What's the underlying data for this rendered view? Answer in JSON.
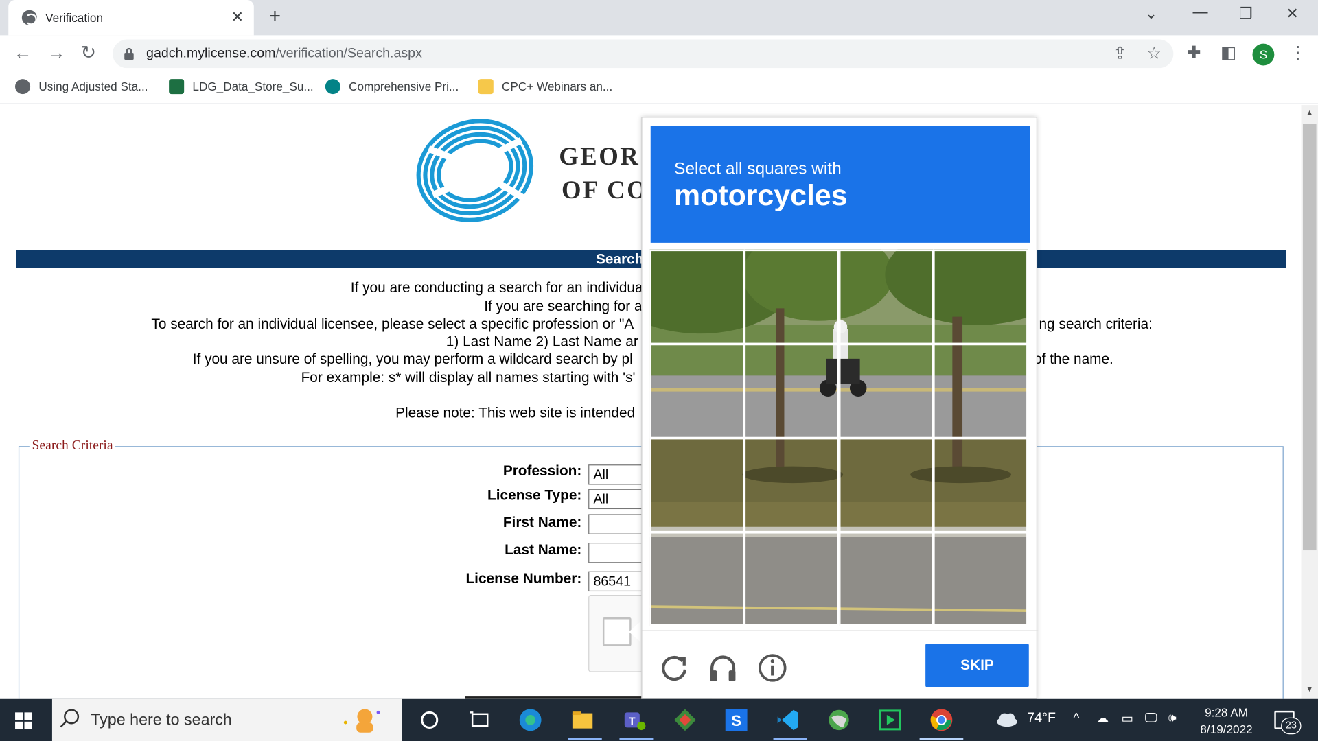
{
  "browser": {
    "tab_title": "Verification",
    "tab_close": "✕",
    "new_tab": "+",
    "url_host": "gadch.mylicense.com",
    "url_path": "/verification/Search.aspx",
    "profile_initial": "S",
    "bookmarks": [
      {
        "label": "Using Adjusted Sta...",
        "icon": "globe-icon",
        "color": "#5f6368"
      },
      {
        "label": "LDG_Data_Store_Su...",
        "icon": "excel-icon",
        "color": "#1d6f42"
      },
      {
        "label": "Comprehensive Pri...",
        "icon": "sharepoint-icon",
        "color": "#038387"
      },
      {
        "label": "CPC+ Webinars an...",
        "icon": "folder-icon",
        "color": "#f6c84a"
      }
    ]
  },
  "page": {
    "logo_line1": "GEOR",
    "logo_line2": "OF CO",
    "banner": "Search for a Pro",
    "intro_lines": [
      "If you are conducting a search for an individual lice",
      "If you are searching for a",
      "To search for an individual licensee, please select a specific profession or \"A",
      "1) Last Name 2) Last Name ar",
      "If you are unsure of spelling, you may perform a wildcard search by pl",
      "For example: s* will display all names starting with 's'"
    ],
    "intro_right": [
      "ng search criteria:",
      "of the name."
    ],
    "note": "Please note: This web site is intended",
    "criteria_legend": "Search Criteria",
    "fields": {
      "profession_label": "Profession:",
      "profession_value": "All",
      "license_type_label": "License Type:",
      "license_type_value": "All",
      "first_name_label": "First Name:",
      "first_name_value": "",
      "last_name_label": "Last Name:",
      "last_name_value": "",
      "license_number_label": "License Number:",
      "license_number_value": "86541"
    }
  },
  "captcha": {
    "prompt": "Select all squares with",
    "object": "motorcycles",
    "skip_label": "SKIP",
    "header_color": "#1a73e8",
    "footer_icons": [
      "reload-icon",
      "audio-icon",
      "info-icon"
    ]
  },
  "taskbar": {
    "search_placeholder": "Type here to search",
    "weather": "74°F",
    "time": "9:28 AM",
    "date": "8/19/2022",
    "notification_count": "23"
  }
}
